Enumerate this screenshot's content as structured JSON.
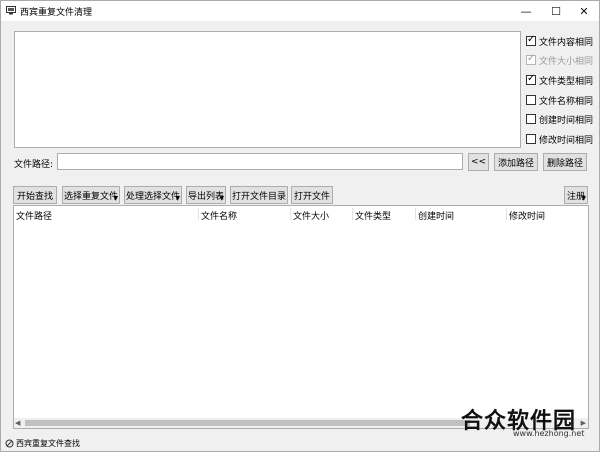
{
  "window": {
    "title": "西宾重复文件清理",
    "minimize": "—",
    "maximize": "☐",
    "close": "✕"
  },
  "options": [
    {
      "label": "文件内容相同",
      "checked": true,
      "disabled": false
    },
    {
      "label": "文件大小相同",
      "checked": true,
      "disabled": true
    },
    {
      "label": "文件类型相同",
      "checked": true,
      "disabled": false
    },
    {
      "label": "文件名称相同",
      "checked": false,
      "disabled": false
    },
    {
      "label": "创建时间相同",
      "checked": false,
      "disabled": false
    },
    {
      "label": "修改时间相同",
      "checked": false,
      "disabled": false
    }
  ],
  "path": {
    "label": "文件路径:",
    "value": "",
    "browse_label": "<<",
    "add_label": "添加路径",
    "remove_label": "删除路径"
  },
  "toolbar": {
    "start_search": "开始查找",
    "select_duplicates": "选择重复文件",
    "process_selected": "处理选择文件",
    "export_list": "导出列表",
    "open_dir": "打开文件目录",
    "open_file": "打开文件",
    "register": "注册"
  },
  "table": {
    "columns": [
      "文件路径",
      "文件名称",
      "文件大小",
      "文件类型",
      "创建时间",
      "修改时间"
    ]
  },
  "statusbar": {
    "text": "西宾重复文件查找"
  },
  "watermark": {
    "logo": "合众软件园",
    "url": "www.hezhong.net"
  }
}
